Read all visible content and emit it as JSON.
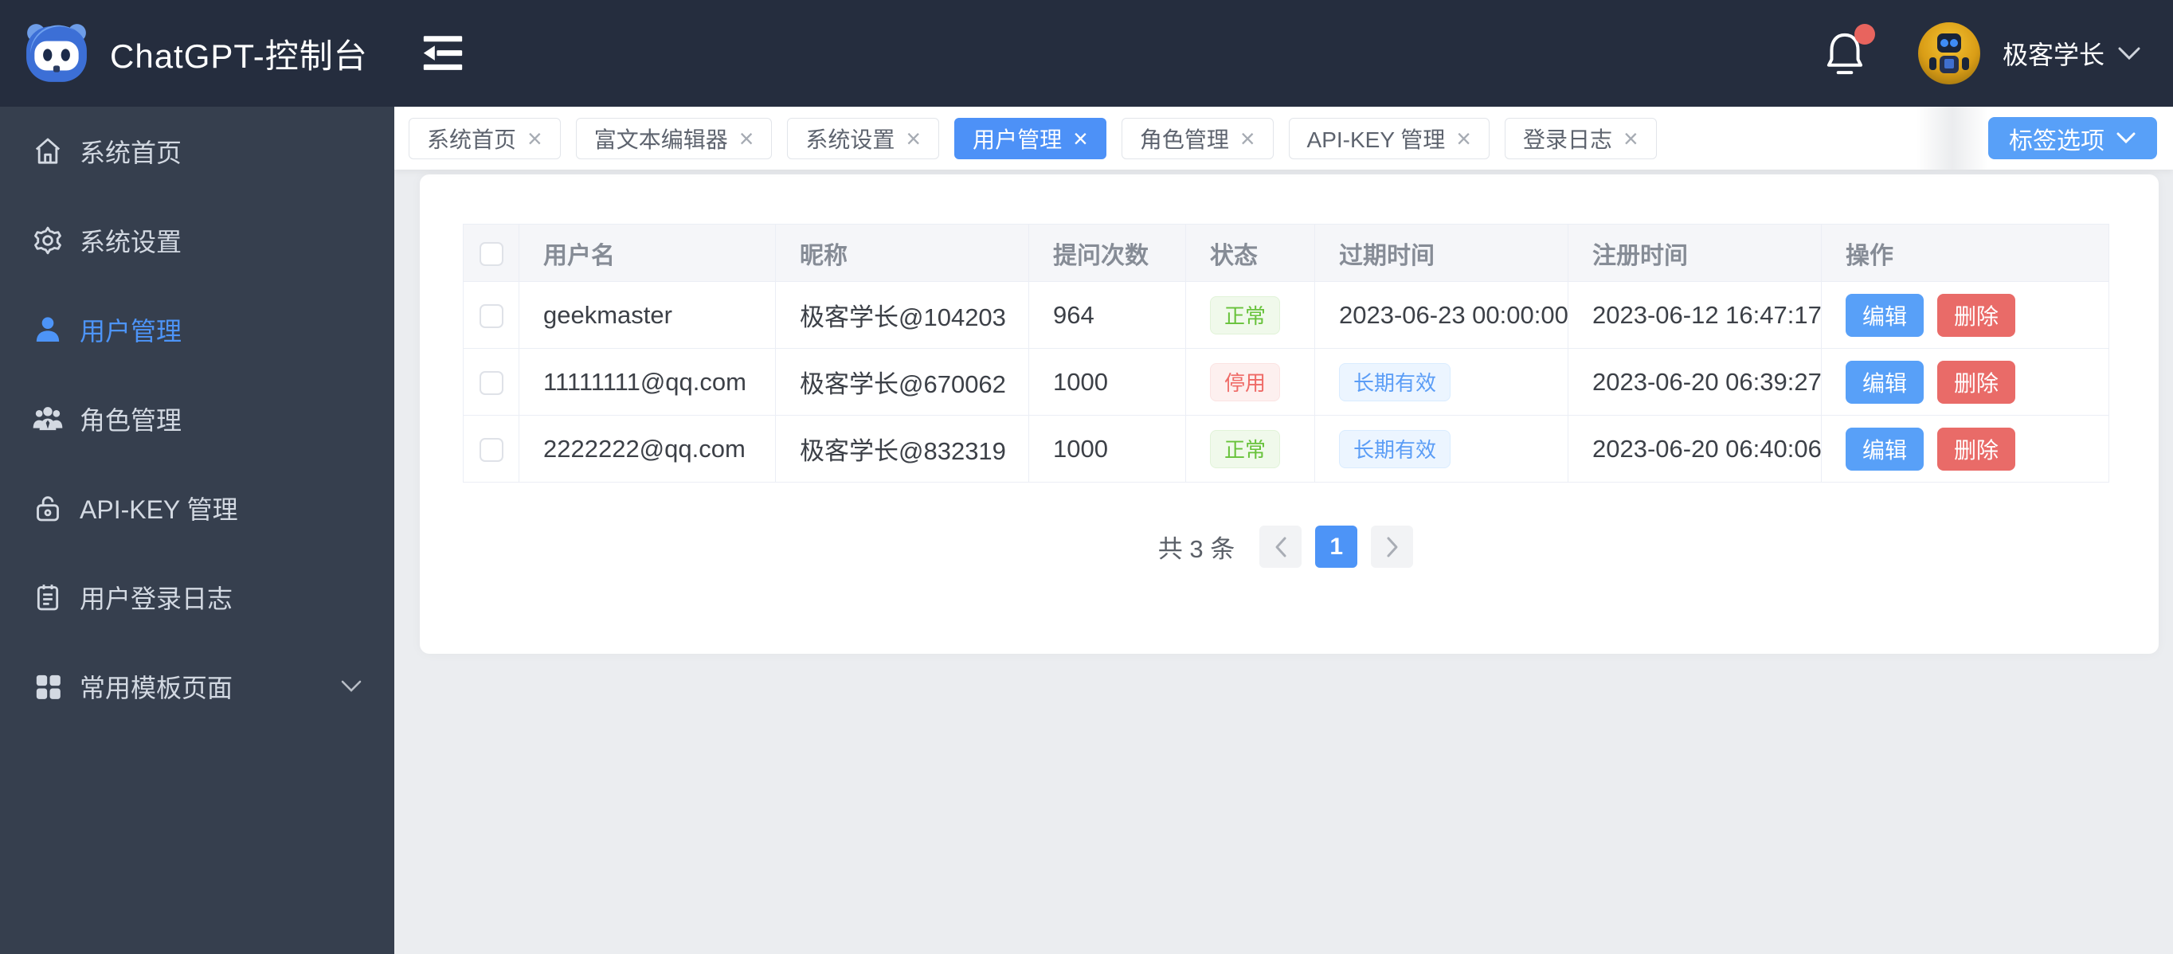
{
  "header": {
    "title": "ChatGPT-控制台",
    "username": "极客学长",
    "has_notification": true
  },
  "sidebar": {
    "items": [
      {
        "id": "home",
        "label": "系统首页",
        "icon": "home-icon",
        "active": false,
        "has_submenu": false
      },
      {
        "id": "system-settings",
        "label": "系统设置",
        "icon": "gear-icon",
        "active": false,
        "has_submenu": false
      },
      {
        "id": "user-management",
        "label": "用户管理",
        "icon": "user-icon",
        "active": true,
        "has_submenu": false
      },
      {
        "id": "role-management",
        "label": "角色管理",
        "icon": "team-icon",
        "active": false,
        "has_submenu": false
      },
      {
        "id": "api-key",
        "label": "API-KEY 管理",
        "icon": "lock-icon",
        "active": false,
        "has_submenu": false
      },
      {
        "id": "login-log",
        "label": "用户登录日志",
        "icon": "journal-icon",
        "active": false,
        "has_submenu": false
      },
      {
        "id": "templates",
        "label": "常用模板页面",
        "icon": "grid-icon",
        "active": false,
        "has_submenu": true
      }
    ]
  },
  "tabbar": {
    "tabs": [
      {
        "id": "home",
        "label": "系统首页",
        "active": false
      },
      {
        "id": "rich-text-editor",
        "label": "富文本编辑器",
        "active": false
      },
      {
        "id": "system-settings",
        "label": "系统设置",
        "active": false
      },
      {
        "id": "user-management",
        "label": "用户管理",
        "active": true
      },
      {
        "id": "role-management",
        "label": "角色管理",
        "active": false
      },
      {
        "id": "api-key",
        "label": "API-KEY 管理",
        "active": false
      },
      {
        "id": "login-log",
        "label": "登录日志",
        "active": false
      }
    ],
    "options_button_label": "标签选项"
  },
  "table": {
    "columns": [
      "用户名",
      "昵称",
      "提问次数",
      "状态",
      "过期时间",
      "注册时间",
      "操作"
    ],
    "rows": [
      {
        "username": "geekmaster",
        "nickname": "极客学长@104203",
        "question_count": "964",
        "status": {
          "label": "正常",
          "type": "success"
        },
        "expire": {
          "label": "2023-06-23 00:00:00",
          "type": "text"
        },
        "register_time": "2023-06-12 16:47:17"
      },
      {
        "username": "11111111@qq.com",
        "nickname": "极客学长@670062",
        "question_count": "1000",
        "status": {
          "label": "停用",
          "type": "danger"
        },
        "expire": {
          "label": "长期有效",
          "type": "tag"
        },
        "register_time": "2023-06-20 06:39:27"
      },
      {
        "username": "2222222@qq.com",
        "nickname": "极客学长@832319",
        "question_count": "1000",
        "status": {
          "label": "正常",
          "type": "success"
        },
        "expire": {
          "label": "长期有效",
          "type": "tag"
        },
        "register_time": "2023-06-20 06:40:06"
      }
    ],
    "edit_label": "编辑",
    "delete_label": "删除"
  },
  "pagination": {
    "total_label": "共 3 条",
    "active_page": "1"
  },
  "colors": {
    "accent": "#4d94f7",
    "danger": "#e96b68",
    "success": "#67c23a",
    "header_bg": "#252d3e",
    "sidebar_bg": "#363f4e",
    "content_bg": "#ebedf0"
  }
}
